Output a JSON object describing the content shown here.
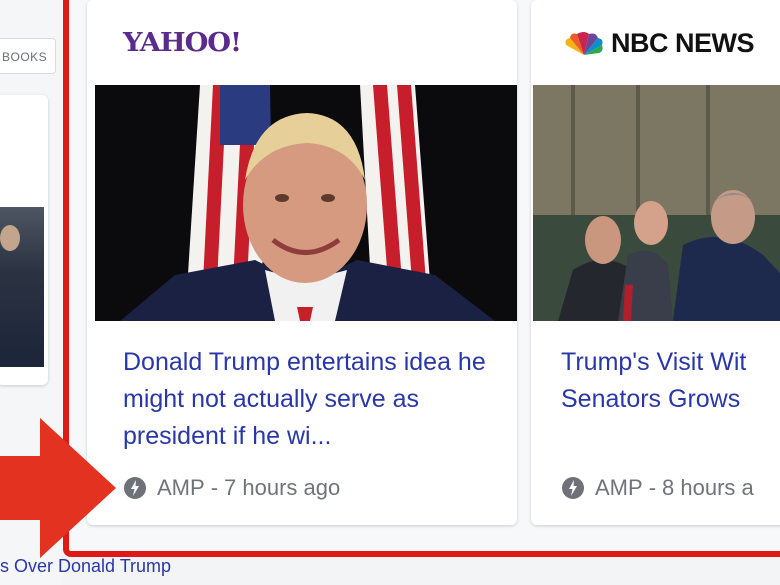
{
  "sidebar": {
    "tab_label": "BOOKS"
  },
  "cards": [
    {
      "source": "YAHOO!",
      "headline": "Donald Trump entertains idea he might not actually serve as president if he wi...",
      "badge": "AMP",
      "separator": "-",
      "time": "7 hours ago"
    },
    {
      "source": "NBC NEWS",
      "headline_line1": "Trump's Visit Wit",
      "headline_line2": "Senators Grows",
      "badge": "AMP",
      "separator": "-",
      "time": "8 hours a"
    }
  ],
  "bottom_link": "s Over Donald Trump",
  "colors": {
    "highlight_frame": "#e01818",
    "arrow": "#e3321f",
    "link": "#2a37a8",
    "yahoo_brand": "#5b2a8e"
  },
  "icons": [
    "amp-icon",
    "nbc-peacock-icon",
    "arrow-icon"
  ]
}
